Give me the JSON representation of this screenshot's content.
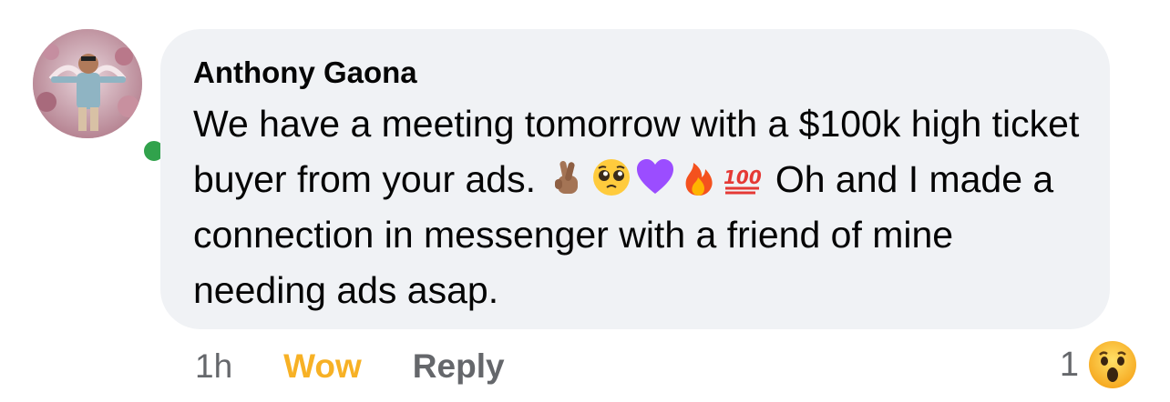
{
  "comment": {
    "author": "Anthony Gaona",
    "text_part1": "We have a meeting tomorrow with a $100k high ticket buyer from your ads.",
    "text_part2": "Oh and I made a connection in messenger with a friend of mine needing ads asap.",
    "emojis": [
      "crossed-fingers-icon",
      "pleading-face-icon",
      "purple-heart-icon",
      "fire-icon",
      "hundred-points-icon"
    ],
    "online": true
  },
  "actions": {
    "time": "1h",
    "reaction_label": "Wow",
    "reply_label": "Reply"
  },
  "reactions": {
    "count": "1",
    "icon": "wow-reaction-icon"
  },
  "colors": {
    "bubble": "#f0f2f5",
    "wow": "#f7b125",
    "muted": "#65676b",
    "online": "#31a24c"
  }
}
